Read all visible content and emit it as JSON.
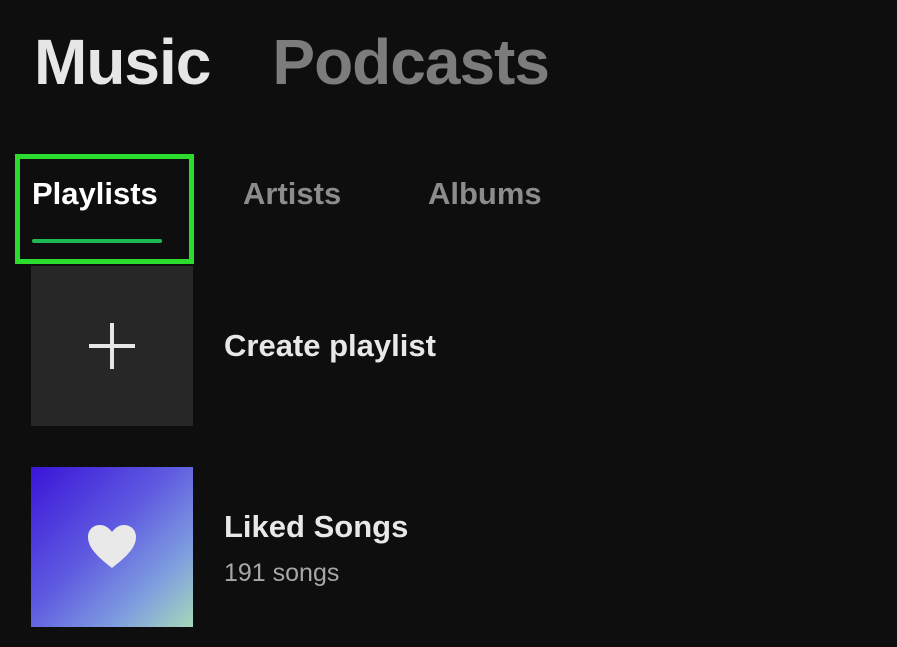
{
  "header": {
    "tabs": [
      {
        "label": "Music",
        "active": true
      },
      {
        "label": "Podcasts",
        "active": false
      }
    ]
  },
  "filters": {
    "tabs": [
      {
        "label": "Playlists",
        "active": true
      },
      {
        "label": "Artists",
        "active": false
      },
      {
        "label": "Albums",
        "active": false
      }
    ],
    "highlight_color": "#2bdc2f",
    "underline_color": "#1db954"
  },
  "library": {
    "items": [
      {
        "title": "Create playlist",
        "icon": "plus-icon"
      },
      {
        "title": "Liked Songs",
        "subtitle": "191 songs",
        "icon": "heart-icon"
      }
    ]
  },
  "colors": {
    "background": "#0e0e0e",
    "tile_background": "#272727"
  }
}
